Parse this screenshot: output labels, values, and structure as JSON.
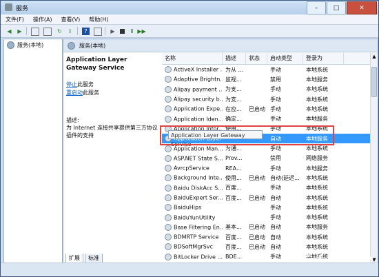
{
  "window": {
    "title": "服务",
    "minimize": "–",
    "maximize": "□",
    "close": "✕"
  },
  "menu": [
    "文件(F)",
    "操作(A)",
    "查看(V)",
    "帮助(H)"
  ],
  "left_tree": {
    "root": "服务(本地)"
  },
  "right_header": {
    "title": "服务(本地)"
  },
  "service_detail": {
    "name": "Application Layer Gateway Service",
    "stop_link": "停止",
    "stop_suffix": "此服务",
    "restart_link": "重启动",
    "restart_suffix": "此服务",
    "desc_label": "描述:",
    "description": "为 Internet 连接共享提供第三方协议插件的支持"
  },
  "columns": [
    "名称",
    "描述",
    "状态",
    "启动类型",
    "登录为"
  ],
  "rows": [
    {
      "name": "ActiveX Installer ...",
      "desc": "为从 ...",
      "status": "",
      "startup": "手动",
      "logon": "本地系统"
    },
    {
      "name": "Adaptive Brightn...",
      "desc": "监视...",
      "status": "",
      "startup": "禁用",
      "logon": "本地服务"
    },
    {
      "name": "Alipay payment ...",
      "desc": "为支...",
      "status": "",
      "startup": "手动",
      "logon": "本地系统"
    },
    {
      "name": "Alipay security b...",
      "desc": "为支...",
      "status": "",
      "startup": "手动",
      "logon": "本地系统"
    },
    {
      "name": "Application Expe...",
      "desc": "在应...",
      "status": "已启动",
      "startup": "手动",
      "logon": "本地系统"
    },
    {
      "name": "Application Iden...",
      "desc": "确定...",
      "status": "",
      "startup": "手动",
      "logon": "本地服务"
    },
    {
      "name": "Application Infor...",
      "desc": "使用...",
      "status": "",
      "startup": "手动",
      "logon": "本地系统"
    },
    {
      "name": "Application Layer Gateway Service",
      "desc": "",
      "status": "",
      "startup": "自动",
      "logon": "本地服务",
      "selected": true
    },
    {
      "name": "Application Man...",
      "desc": "为通...",
      "status": "",
      "startup": "手动",
      "logon": "本地系统"
    },
    {
      "name": "ASP.NET State S...",
      "desc": "Prov...",
      "status": "",
      "startup": "禁用",
      "logon": "网络服务"
    },
    {
      "name": "AvrcpService",
      "desc": "REA...",
      "status": "",
      "startup": "手动",
      "logon": "本地服务"
    },
    {
      "name": "Background Inte...",
      "desc": "使用...",
      "status": "已启动",
      "startup": "自动(延迟...",
      "logon": "本地系统"
    },
    {
      "name": "Baidu DiskAcc S...",
      "desc": "百度...",
      "status": "",
      "startup": "手动",
      "logon": "本地系统"
    },
    {
      "name": "BaiduExpert Ser...",
      "desc": "百度...",
      "status": "已启动",
      "startup": "自动",
      "logon": "本地系统"
    },
    {
      "name": "BaiduHips",
      "desc": "",
      "status": "",
      "startup": "手动",
      "logon": "本地系统"
    },
    {
      "name": "BaiduYunUtility",
      "desc": "",
      "status": "",
      "startup": "手动",
      "logon": "本地系统"
    },
    {
      "name": "Base Filtering En...",
      "desc": "基本...",
      "status": "已启动",
      "startup": "自动",
      "logon": "本地服务"
    },
    {
      "name": "BDMRTP Service",
      "desc": "百度...",
      "status": "已启动",
      "startup": "自动",
      "logon": "本地系统"
    },
    {
      "name": "BDSoftMgrSvc",
      "desc": "百度...",
      "status": "已启动",
      "startup": "自动",
      "logon": "本地系统"
    },
    {
      "name": "BitLocker Drive ...",
      "desc": "BDE...",
      "status": "",
      "startup": "手动",
      "logon": "本地系统"
    }
  ],
  "tooltip": "Application Layer Gateway Service",
  "tabs": [
    "扩展",
    "标准"
  ],
  "watermark": "Baidu 经验",
  "toolbar_icons": [
    "back-icon",
    "forward-icon",
    "console-tree-icon",
    "properties-icon",
    "refresh-icon",
    "export-icon",
    "help-icon",
    "show-hide-icon",
    "play-icon",
    "stop-icon",
    "pause-icon",
    "restart-icon"
  ]
}
